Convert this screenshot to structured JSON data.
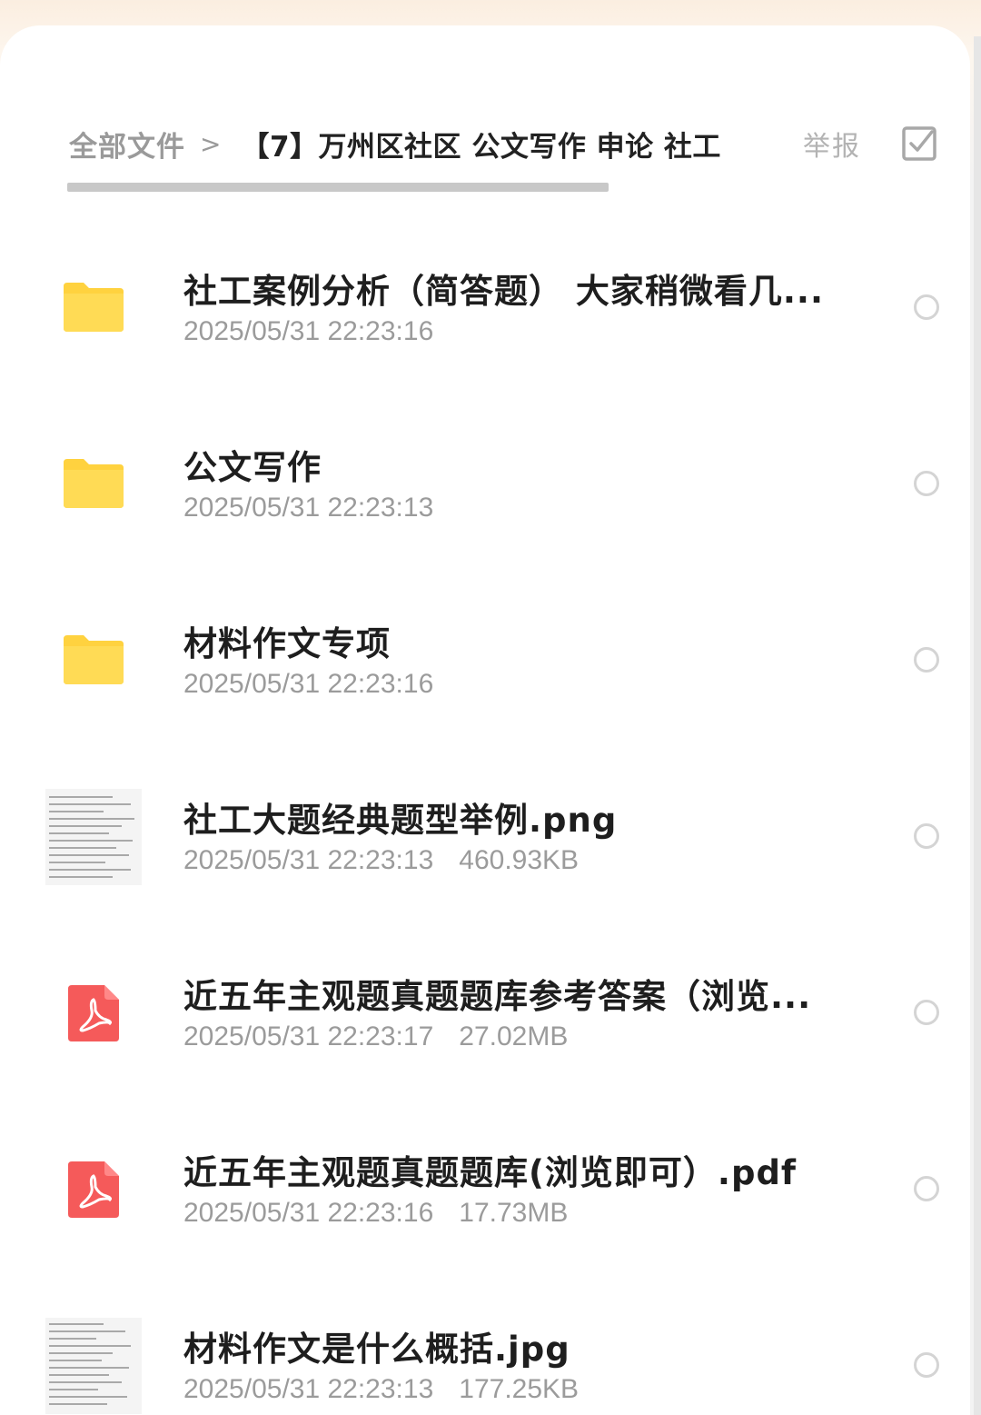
{
  "header": {
    "breadcrumb_root": "全部文件",
    "breadcrumb_separator": ">",
    "breadcrumb_current": "【7】万州区社区 公文写作 申论 社工",
    "report_label": "举报",
    "select_all_icon": "checkbox-select-all-icon"
  },
  "files": [
    {
      "name": "社工案例分析（简答题） 大家稍微看几...",
      "date": "2025/05/31 22:23:16",
      "size": "",
      "type": "folder",
      "icon": "folder-icon"
    },
    {
      "name": "公文写作",
      "date": "2025/05/31 22:23:13",
      "size": "",
      "type": "folder",
      "icon": "folder-icon"
    },
    {
      "name": "材料作文专项",
      "date": "2025/05/31 22:23:16",
      "size": "",
      "type": "folder",
      "icon": "folder-icon"
    },
    {
      "name": "社工大题经典题型举例.png",
      "date": "2025/05/31 22:23:13",
      "size": "460.93KB",
      "type": "image",
      "icon": "image-thumbnail"
    },
    {
      "name": "近五年主观题真题题库参考答案（浏览...",
      "date": "2025/05/31 22:23:17",
      "size": "27.02MB",
      "type": "pdf",
      "icon": "pdf-icon"
    },
    {
      "name": "近五年主观题真题题库(浏览即可）.pdf",
      "date": "2025/05/31 22:23:16",
      "size": "17.73MB",
      "type": "pdf",
      "icon": "pdf-icon"
    },
    {
      "name": "材料作文是什么概括.jpg",
      "date": "2025/05/31 22:23:13",
      "size": "177.25KB",
      "type": "image",
      "icon": "image-thumbnail"
    }
  ],
  "colors": {
    "folder": "#ffd23f",
    "pdf": "#f55a5a",
    "radio_border": "#d4d4d4",
    "title_text": "#1e1e1e",
    "meta_text": "#9b9b9b"
  }
}
